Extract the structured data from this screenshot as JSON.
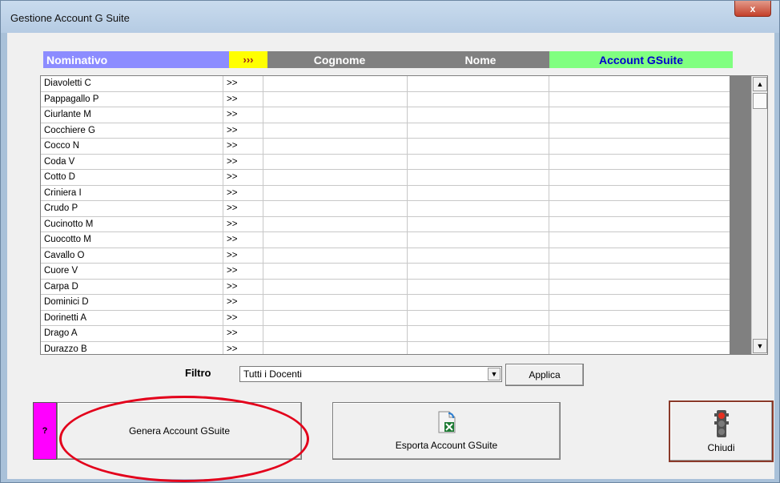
{
  "window": {
    "title": "Gestione Account G Suite",
    "close_label": "x"
  },
  "headers": {
    "nominativo": "Nominativo",
    "arrows": "›››",
    "cognome": "Cognome",
    "nome": "Nome",
    "account": "Account GSuite"
  },
  "rows": [
    {
      "nominativo": "Diavoletti C",
      "arrow": ">>"
    },
    {
      "nominativo": "Pappagallo P",
      "arrow": ">>"
    },
    {
      "nominativo": "Ciurlante M",
      "arrow": ">>"
    },
    {
      "nominativo": "Cocchiere G",
      "arrow": ">>"
    },
    {
      "nominativo": "Cocco N",
      "arrow": ">>"
    },
    {
      "nominativo": "Coda V",
      "arrow": ">>"
    },
    {
      "nominativo": "Cotto D",
      "arrow": ">>"
    },
    {
      "nominativo": "Criniera I",
      "arrow": ">>"
    },
    {
      "nominativo": "Crudo P",
      "arrow": ">>"
    },
    {
      "nominativo": "Cucinotto M",
      "arrow": ">>"
    },
    {
      "nominativo": "Cuocotto M",
      "arrow": ">>"
    },
    {
      "nominativo": "Cavallo O",
      "arrow": ">>"
    },
    {
      "nominativo": "Cuore V",
      "arrow": ">>"
    },
    {
      "nominativo": "Carpa D",
      "arrow": ">>"
    },
    {
      "nominativo": "Dominici D",
      "arrow": ">>"
    },
    {
      "nominativo": "Dorinetti A",
      "arrow": ">>"
    },
    {
      "nominativo": "Drago A",
      "arrow": ">>"
    },
    {
      "nominativo": "Durazzo B",
      "arrow": ">>"
    }
  ],
  "filter": {
    "label": "Filtro",
    "selected": "Tutti i Docenti",
    "apply_label": "Applica"
  },
  "buttons": {
    "help": "?",
    "genera": "Genera Account GSuite",
    "esporta": "Esporta Account GSuite",
    "chiudi": "Chiudi"
  },
  "colors": {
    "nominativo_header": "#8c8cff",
    "arrows_header": "#ffff00",
    "gray_header": "#808080",
    "account_header": "#80ff80",
    "help_button": "#ff00ff",
    "highlight": "#e3001b"
  },
  "icons": {
    "scroll_up": "scroll-up-arrow-icon",
    "scroll_down": "scroll-down-arrow-icon",
    "dropdown": "dropdown-arrow-icon",
    "excel": "excel-export-icon",
    "traffic_light": "traffic-light-icon"
  }
}
